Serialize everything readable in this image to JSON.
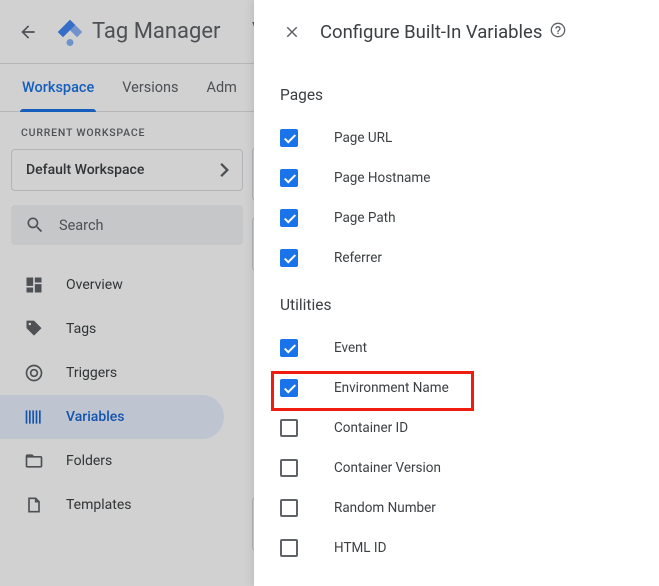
{
  "header": {
    "app_title": "Tag Manager"
  },
  "tabs": {
    "workspace": "Workspace",
    "versions": "Versions",
    "admin": "Adm"
  },
  "workspace": {
    "label": "CURRENT WORKSPACE",
    "name": "Default Workspace"
  },
  "search": {
    "placeholder": "Search"
  },
  "nav": {
    "overview": "Overview",
    "tags": "Tags",
    "triggers": "Triggers",
    "variables": "Variables",
    "folders": "Folders",
    "templates": "Templates"
  },
  "panel": {
    "title": "Configure Built-In Variables",
    "sections": {
      "pages": {
        "title": "Pages",
        "items": [
          {
            "label": "Page URL",
            "checked": true
          },
          {
            "label": "Page Hostname",
            "checked": true
          },
          {
            "label": "Page Path",
            "checked": true
          },
          {
            "label": "Referrer",
            "checked": true
          }
        ]
      },
      "utilities": {
        "title": "Utilities",
        "items": [
          {
            "label": "Event",
            "checked": true
          },
          {
            "label": "Environment Name",
            "checked": true
          },
          {
            "label": "Container ID",
            "checked": false
          },
          {
            "label": "Container Version",
            "checked": false
          },
          {
            "label": "Random Number",
            "checked": false
          },
          {
            "label": "HTML ID",
            "checked": false
          }
        ]
      }
    }
  }
}
